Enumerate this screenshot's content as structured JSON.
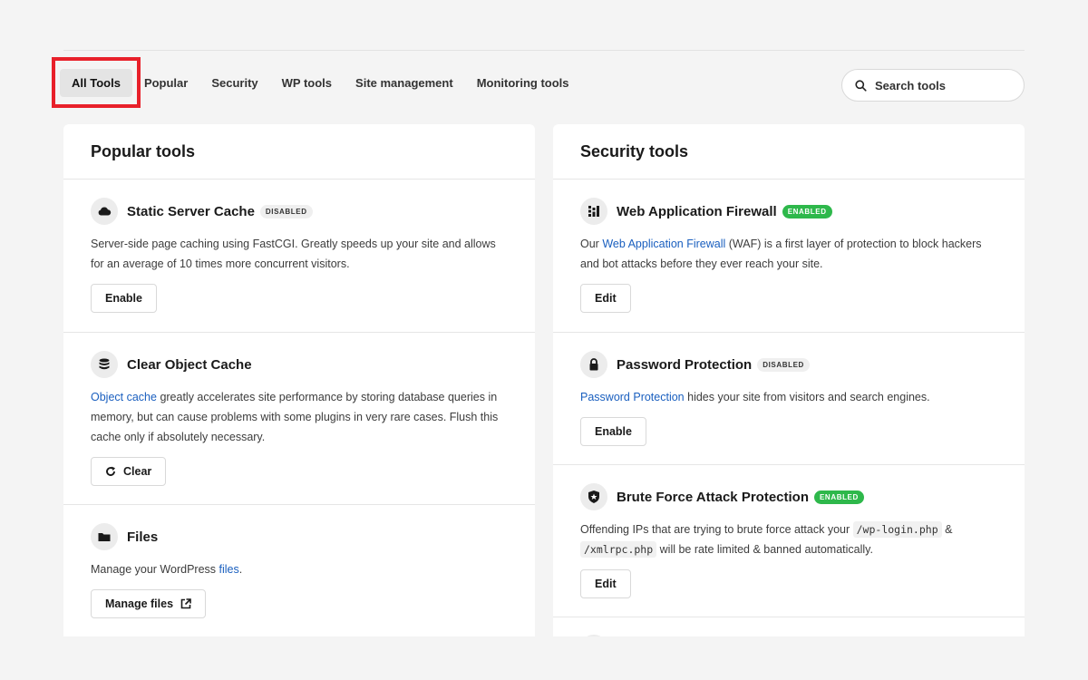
{
  "tabs": [
    {
      "label": "All Tools",
      "active": true
    },
    {
      "label": "Popular"
    },
    {
      "label": "Security"
    },
    {
      "label": "WP tools"
    },
    {
      "label": "Site management"
    },
    {
      "label": "Monitoring tools"
    }
  ],
  "search": {
    "placeholder": "Search tools",
    "icon": "search-icon"
  },
  "popular": {
    "title": "Popular tools",
    "tools": [
      {
        "name": "Static Server Cache",
        "badge": "DISABLED",
        "icon": "cloud-icon",
        "desc": "Server-side page caching using FastCGI. Greatly speeds up your site and allows for an average of 10 times more concurrent visitors.",
        "button": "Enable"
      },
      {
        "name": "Clear Object Cache",
        "icon": "database-icon",
        "desc_link": "Object cache",
        "desc_rest": " greatly accelerates site performance by storing database queries in memory, but can cause problems with some plugins in very rare cases. Flush this cache only if absolutely necessary.",
        "button": "Clear",
        "button_icon": "refresh-icon"
      },
      {
        "name": "Files",
        "icon": "folder-icon",
        "desc_pre": "Manage your WordPress ",
        "desc_link": "files",
        "desc_post": ".",
        "button": "Manage files",
        "button_icon": "external-link-icon"
      }
    ]
  },
  "security": {
    "title": "Security tools",
    "tools": [
      {
        "name": "Web Application Firewall",
        "badge": "ENABLED",
        "icon": "firewall-icon",
        "desc_pre": "Our ",
        "desc_link": "Web Application Firewall",
        "desc_post": " (WAF) is a first layer of protection to block hackers and bot attacks before they ever reach your site.",
        "button": "Edit"
      },
      {
        "name": "Password Protection",
        "badge": "DISABLED",
        "icon": "lock-icon",
        "desc_link": "Password Protection",
        "desc_post": " hides your site from visitors and search engines.",
        "button": "Enable"
      },
      {
        "name": "Brute Force Attack Protection",
        "badge": "ENABLED",
        "icon": "shield-icon",
        "desc_pre": "Offending IPs that are trying to brute force attack your ",
        "code1": "/wp-login.php",
        "desc_mid": " & ",
        "code2": "/xmlrpc.php",
        "desc_post": " will be rate limited & banned automatically.",
        "button": "Edit"
      }
    ]
  }
}
